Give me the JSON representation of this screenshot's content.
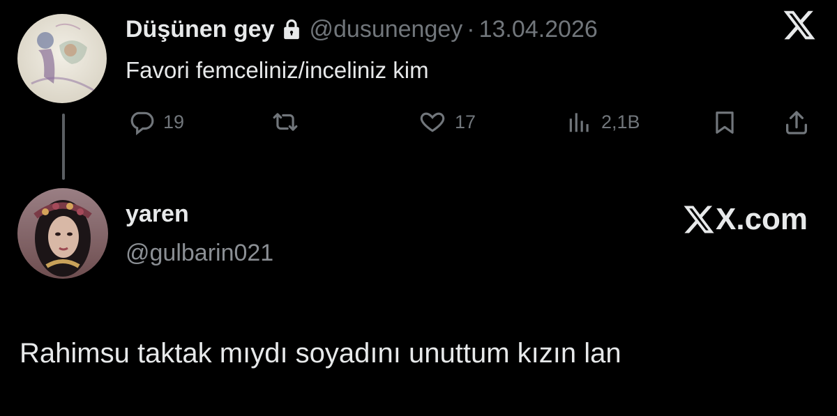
{
  "colors": {
    "background": "#000000",
    "text": "#e7e9ea",
    "muted": "#71767b"
  },
  "quoted_post": {
    "display_name": "Düşünen gey",
    "lock_icon": "lock-icon",
    "handle": "@dusunengey",
    "separator": "·",
    "date": "13.04.2026",
    "text": "Favori femceliniz/inceliniz kim",
    "actions": {
      "reply_count": "19",
      "repost_count": "",
      "like_count": "17",
      "views_count": "2,1B"
    }
  },
  "reply": {
    "display_name": "yaren",
    "handle": "@gulbarin021",
    "brand": "X.com",
    "text": "Rahimsu taktak mıydı soyadını unuttum kızın lan"
  }
}
